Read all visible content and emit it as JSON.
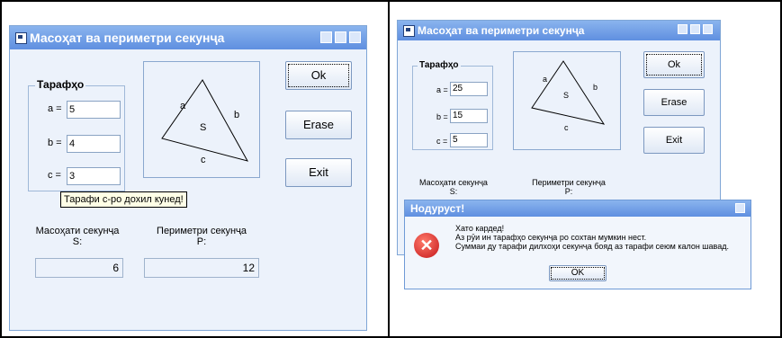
{
  "left_window": {
    "title": "Масоҳат ва периметри секунҷа",
    "group_label": "Тарафҳо",
    "fields": [
      {
        "label": "a =",
        "value": "5"
      },
      {
        "label": "b =",
        "value": "4"
      },
      {
        "label": "c =",
        "value": "3"
      }
    ],
    "triangle": {
      "a": "a",
      "b": "b",
      "c": "c",
      "s": "S"
    },
    "buttons": {
      "ok": "Ok",
      "erase": "Erase",
      "exit": "Exit"
    },
    "tooltip": "Тарафи c-ро дохил кунед!",
    "area_label_1": "Масоҳати секунҷа",
    "area_label_2": "S:",
    "area_value": "6",
    "perimeter_label_1": "Периметри секунҷа",
    "perimeter_label_2": "P:",
    "perimeter_value": "12"
  },
  "right_window": {
    "title": "Масоҳат ва периметри секунҷа",
    "group_label": "Тарафҳо",
    "fields": [
      {
        "label": "a =",
        "value": "25"
      },
      {
        "label": "b =",
        "value": "15"
      },
      {
        "label": "c =",
        "value": "5"
      }
    ],
    "triangle": {
      "a": "a",
      "b": "b",
      "c": "c",
      "s": "S"
    },
    "buttons": {
      "ok": "Ok",
      "erase": "Erase",
      "exit": "Exit"
    },
    "area_label_1": "Масоҳати секунҷа",
    "area_label_2": "S:",
    "perimeter_label_1": "Периметри секунҷа",
    "perimeter_label_2": "P:"
  },
  "error_dialog": {
    "title": "Нодуруст!",
    "line1": "Хато кардед!",
    "line2": "Аз рӯи ин тарафҳо секунҷа ро сохтан мумкин нест.",
    "line3": "Суммаи ду тарафи дилхоҳи секунҷа бояд аз тарафи сеюм калон шавад.",
    "ok": "OK"
  },
  "icons": [
    "app-icon",
    "minimize-icon",
    "maximize-icon",
    "close-icon",
    "error-icon"
  ],
  "colors": {
    "title_bar": "#5f8fe0",
    "window_bg": "#ecf2fb",
    "error_icon": "#c4161a"
  }
}
